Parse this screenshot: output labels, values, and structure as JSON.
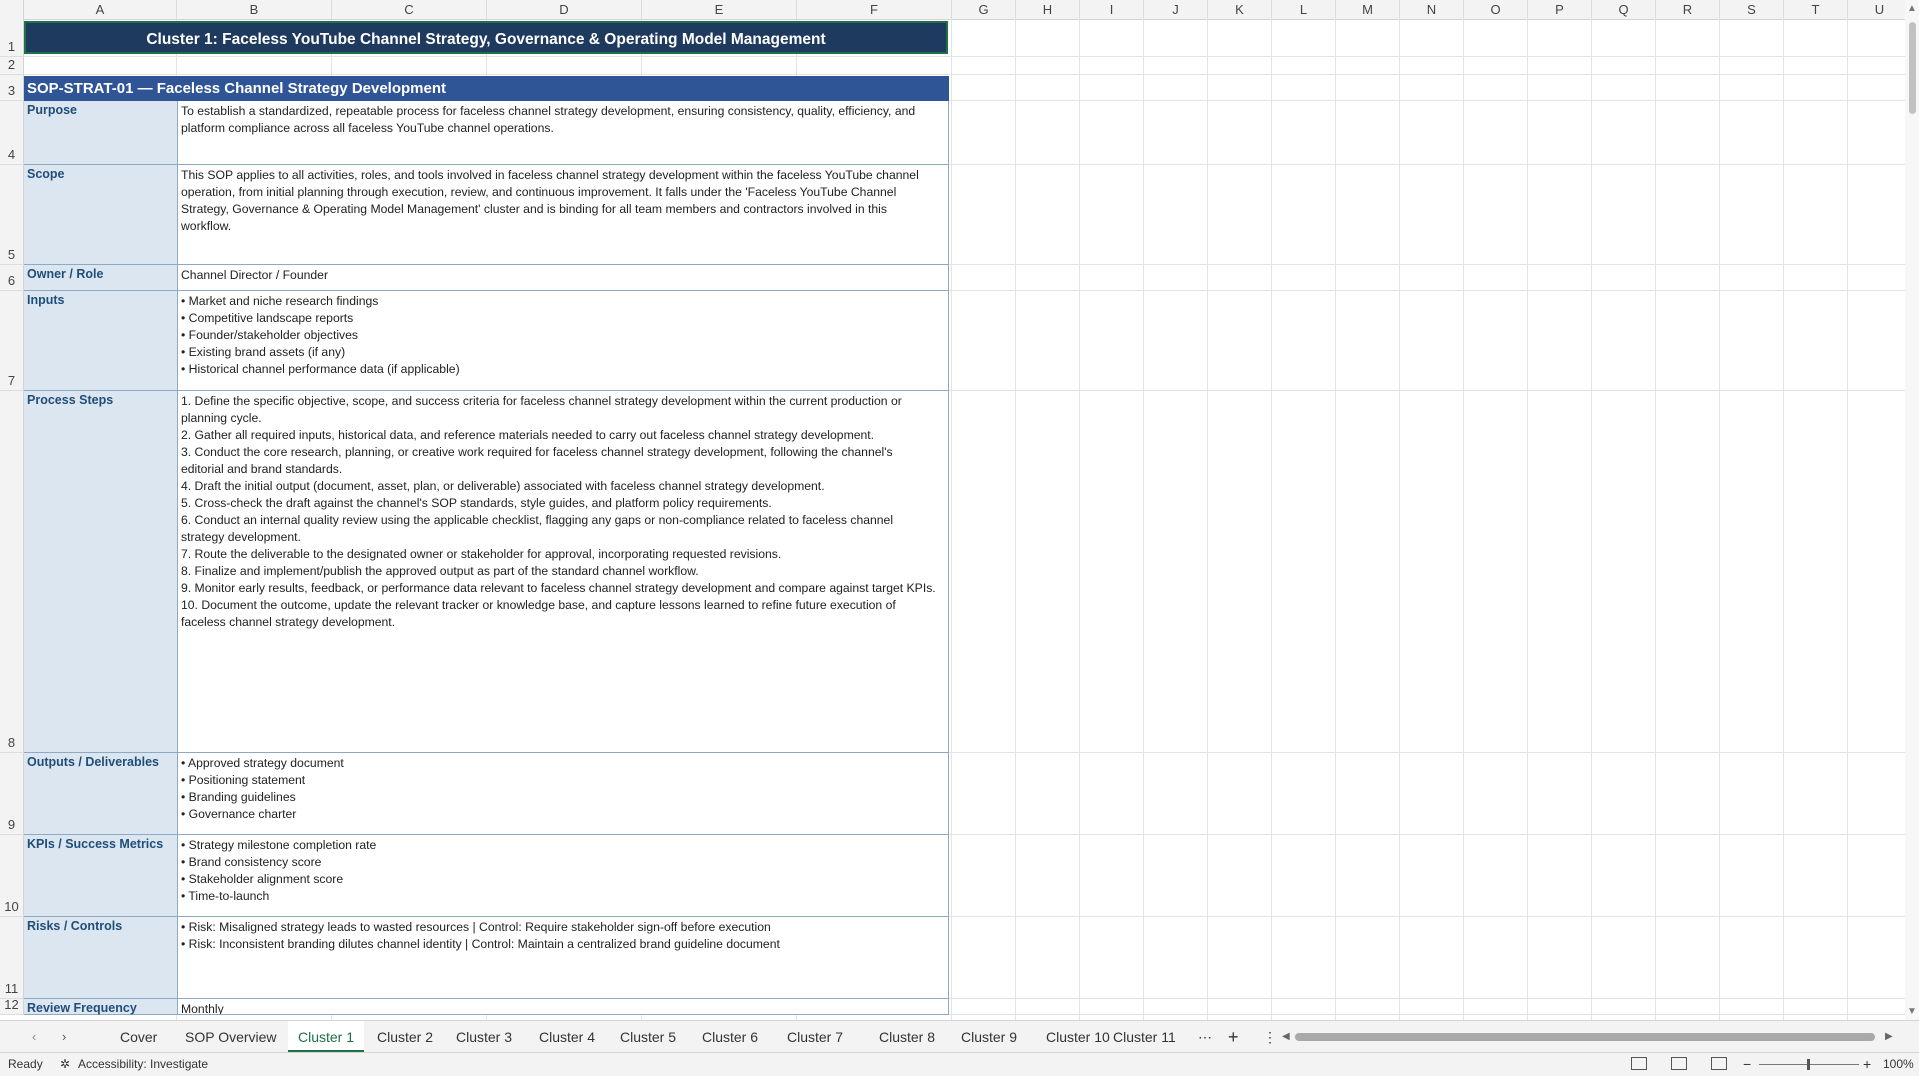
{
  "columns": [
    "A",
    "B",
    "C",
    "D",
    "E",
    "F",
    "G",
    "H",
    "I",
    "J",
    "K",
    "L",
    "M",
    "N",
    "O",
    "P",
    "Q",
    "R",
    "S",
    "T",
    "U"
  ],
  "rows": [
    "1",
    "2",
    "3",
    "4",
    "5",
    "6",
    "7",
    "8",
    "9",
    "10",
    "11",
    "12"
  ],
  "title": "Cluster 1: Faceless YouTube Channel Strategy, Governance & Operating Model Management",
  "sop_header": "SOP-STRAT-01  —  Faceless Channel Strategy Development",
  "sections": [
    {
      "label": "Purpose",
      "content": "To establish a standardized, repeatable process for faceless channel strategy development, ensuring consistency, quality, efficiency, and\nplatform compliance across all faceless YouTube channel operations."
    },
    {
      "label": "Scope",
      "content": "This SOP applies to all activities, roles, and tools involved in faceless channel strategy development within the faceless YouTube channel\noperation, from initial planning through execution, review, and continuous improvement. It falls under the 'Faceless YouTube Channel\nStrategy, Governance & Operating Model Management' cluster and is binding for all team members and contractors involved in this\nworkflow."
    },
    {
      "label": "Owner / Role",
      "content": "Channel Director / Founder"
    },
    {
      "label": "Inputs",
      "content": "• Market and niche research findings\n• Competitive landscape reports\n• Founder/stakeholder objectives\n• Existing brand assets (if any)\n• Historical channel performance data (if applicable)"
    },
    {
      "label": "Process Steps",
      "content": "1. Define the specific objective, scope, and success criteria for faceless channel strategy development within the current production or\nplanning cycle.\n2. Gather all required inputs, historical data, and reference materials needed to carry out faceless channel strategy development.\n3. Conduct the core research, planning, or creative work required for faceless channel strategy development, following the channel's\neditorial and brand standards.\n4. Draft the initial output (document, asset, plan, or deliverable) associated with faceless channel strategy development.\n5. Cross-check the draft against the channel's SOP standards, style guides, and platform policy requirements.\n6. Conduct an internal quality review using the applicable checklist, flagging any gaps or non-compliance related to faceless channel\nstrategy development.\n7. Route the deliverable to the designated owner or stakeholder for approval, incorporating requested revisions.\n8. Finalize and implement/publish the approved output as part of the standard channel workflow.\n9. Monitor early results, feedback, or performance data relevant to faceless channel strategy development and compare against target KPIs.\n10. Document the outcome, update the relevant tracker or knowledge base, and capture lessons learned to refine future execution of\nfaceless channel strategy development."
    },
    {
      "label": "Outputs / Deliverables",
      "content": "• Approved strategy document\n• Positioning statement\n• Branding guidelines\n• Governance charter"
    },
    {
      "label": "KPIs / Success Metrics",
      "content": "• Strategy milestone completion rate\n• Brand consistency score\n• Stakeholder alignment score\n• Time-to-launch"
    },
    {
      "label": "Risks / Controls",
      "content": "• Risk: Misaligned strategy leads to wasted resources | Control: Require stakeholder sign-off before execution\n• Risk: Inconsistent branding dilutes channel identity | Control: Maintain a centralized brand guideline document"
    },
    {
      "label": "Review Frequency",
      "content": "Monthly"
    }
  ],
  "tabs": [
    "Cover",
    "SOP Overview",
    "Cluster 1",
    "Cluster 2",
    "Cluster 3",
    "Cluster 4",
    "Cluster 5",
    "Cluster 6",
    "Cluster 7",
    "Cluster 8",
    "Cluster 9",
    "Cluster 10",
    "Cluster 11"
  ],
  "active_tab": "Cluster 1",
  "status": {
    "ready": "Ready",
    "accessibility": "Accessibility: Investigate",
    "zoom": "100%"
  }
}
